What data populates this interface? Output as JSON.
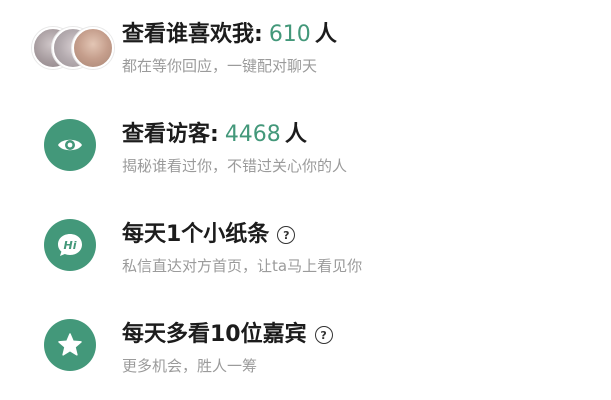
{
  "colors": {
    "accent": "#43987a",
    "title_text": "#1c1c1c",
    "subtitle_text": "#9b9b9b"
  },
  "items": [
    {
      "icon": "avatar-stack",
      "title": "查看谁喜欢我:",
      "count": "610",
      "unit": "人",
      "subtitle": "都在等你回应，一键配对聊天"
    },
    {
      "icon": "eye-icon",
      "title": "查看访客:",
      "count": "4468",
      "unit": "人",
      "subtitle": "揭秘谁看过你，不错过关心你的人"
    },
    {
      "icon": "hi-chat-icon",
      "title": "每天1个小纸条",
      "help": "?",
      "subtitle": "私信直达对方首页，让ta马上看见你"
    },
    {
      "icon": "star-icon",
      "title": "每天多看10位嘉宾",
      "help": "?",
      "subtitle": "更多机会，胜人一筹"
    }
  ]
}
